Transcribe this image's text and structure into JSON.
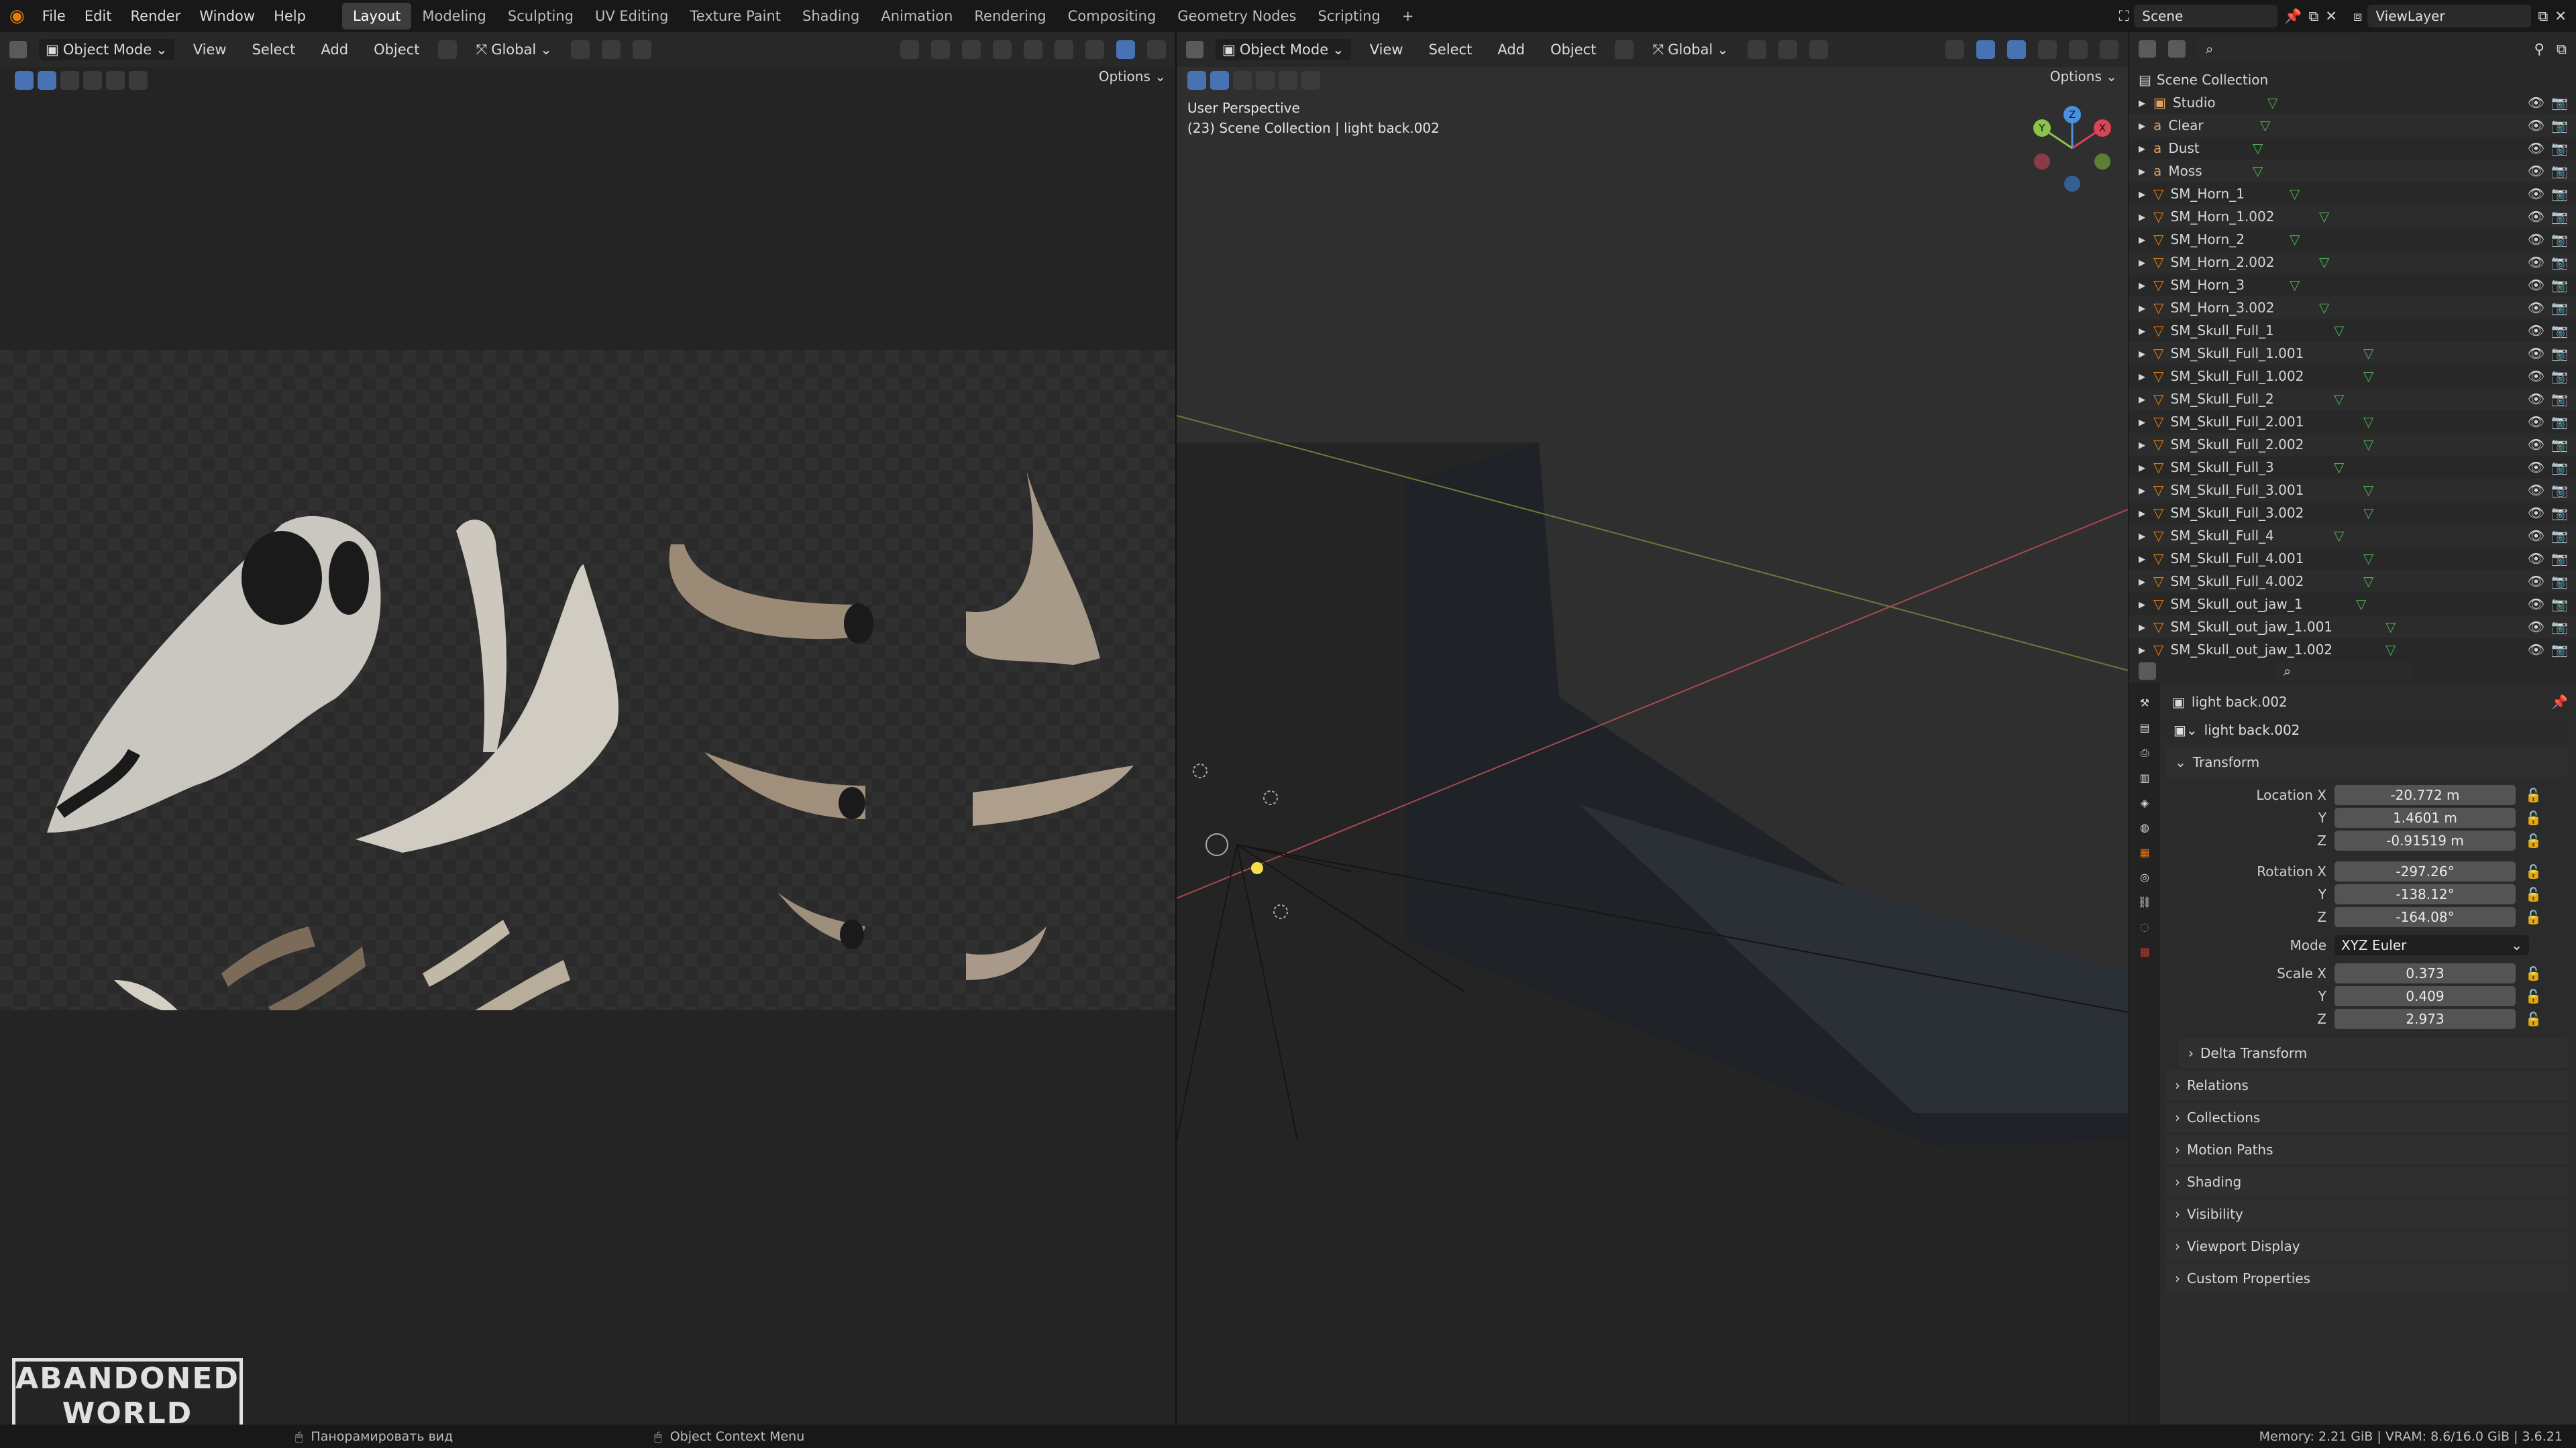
{
  "top_menu": [
    "File",
    "Edit",
    "Render",
    "Window",
    "Help"
  ],
  "workspaces": [
    "Layout",
    "Modeling",
    "Sculpting",
    "UV Editing",
    "Texture Paint",
    "Shading",
    "Animation",
    "Rendering",
    "Compositing",
    "Geometry Nodes",
    "Scripting",
    "+"
  ],
  "active_workspace": "Layout",
  "scene_name": "Scene",
  "view_layer": "ViewLayer",
  "left_editor": {
    "mode": "Object Mode",
    "menus": [
      "View",
      "Select",
      "Add",
      "Object"
    ],
    "transform": "Global",
    "options": "Options"
  },
  "right_editor": {
    "mode": "Object Mode",
    "menus": [
      "View",
      "Select",
      "Add",
      "Object"
    ],
    "transform": "Global",
    "options": "Options",
    "overlay_line1": "User Perspective",
    "overlay_line2": "(23) Scene Collection | light back.002",
    "gizmo": {
      "x": "X",
      "y": "Y",
      "z": "Z"
    }
  },
  "outliner": {
    "root": "Scene Collection",
    "items": [
      "Studio",
      "Clear",
      "Dust",
      "Moss",
      "SM_Horn_1",
      "SM_Horn_1.002",
      "SM_Horn_2",
      "SM_Horn_2.002",
      "SM_Horn_3",
      "SM_Horn_3.002",
      "SM_Skull_Full_1",
      "SM_Skull_Full_1.001",
      "SM_Skull_Full_1.002",
      "SM_Skull_Full_2",
      "SM_Skull_Full_2.001",
      "SM_Skull_Full_2.002",
      "SM_Skull_Full_3",
      "SM_Skull_Full_3.001",
      "SM_Skull_Full_3.002",
      "SM_Skull_Full_4",
      "SM_Skull_Full_4.001",
      "SM_Skull_Full_4.002",
      "SM_Skull_out_jaw_1",
      "SM_Skull_out_jaw_1.001",
      "SM_Skull_out_jaw_1.002"
    ]
  },
  "properties": {
    "object_name": "light back.002",
    "object_data_name": "light back.002",
    "transform_title": "Transform",
    "location": {
      "label_x": "Location X",
      "label_y": "Y",
      "label_z": "Z",
      "x": "-20.772 m",
      "y": "1.4601 m",
      "z": "-0.91519 m"
    },
    "rotation": {
      "label_x": "Rotation X",
      "label_y": "Y",
      "label_z": "Z",
      "x": "-297.26°",
      "y": "-138.12°",
      "z": "-164.08°"
    },
    "mode": {
      "label": "Mode",
      "value": "XYZ Euler"
    },
    "scale": {
      "label_x": "Scale X",
      "label_y": "Y",
      "label_z": "Z",
      "x": "0.373",
      "y": "0.409",
      "z": "2.973"
    },
    "delta": "Delta Transform",
    "panels": [
      "Relations",
      "Collections",
      "Motion Paths",
      "Shading",
      "Visibility",
      "Viewport Display",
      "Custom Properties"
    ]
  },
  "status": {
    "left_hint": "Панорамировать вид",
    "middle_hint": "Object Context Menu",
    "memory": "Memory: 2.21 GiB | VRAM: 8.6/16.0 GiB | 3.6.21"
  },
  "logo": {
    "line1": "ABANDONED",
    "line2": "WORLD"
  },
  "colors": {
    "accent": "#4772b3",
    "viewport_bg": "#3a3a3a",
    "panel_bg": "#2b2b2b",
    "gizmo_x": "#d94355",
    "gizmo_y": "#8bc34a",
    "gizmo_z": "#4a90e2"
  }
}
